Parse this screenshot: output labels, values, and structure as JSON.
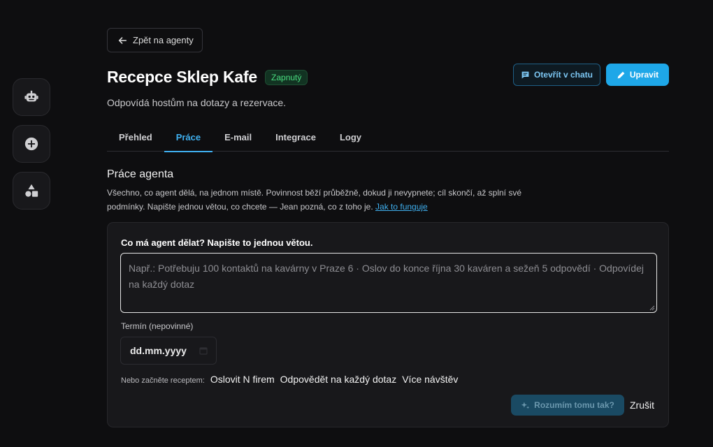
{
  "rail": {
    "items": [
      {
        "icon": "robot-icon"
      },
      {
        "icon": "plus-circle-icon"
      },
      {
        "icon": "shapes-icon"
      }
    ]
  },
  "header": {
    "back_label": "Zpět na agenty",
    "title": "Recepce Sklep Kafe",
    "status_badge": "Zapnutý",
    "subtitle": "Odpovídá hostům na dotazy a rezervace.",
    "open_chat_label": "Otevřít v chatu",
    "edit_label": "Upravit"
  },
  "tabs": [
    {
      "label": "Přehled",
      "active": false
    },
    {
      "label": "Práce",
      "active": true
    },
    {
      "label": "E-mail",
      "active": false
    },
    {
      "label": "Integrace",
      "active": false
    },
    {
      "label": "Logy",
      "active": false
    }
  ],
  "section": {
    "title": "Práce agenta",
    "description": "Všechno, co agent dělá, na jednom místě. Povinnost běží průběžně, dokud ji nevypnete; cíl skončí, až splní své podmínky. Napište jednou větou, co chcete — Jean pozná, co z toho je.",
    "help_link": "Jak to funguje"
  },
  "form": {
    "prompt_label": "Co má agent dělat? Napište to jednou větou.",
    "prompt_placeholder": "Např.: Potřebuju 100 kontaktů na kavárny v Praze 6 · Oslov do konce října 30 kaváren a sežeň 5 odpovědí · Odpovídej na každý dotaz",
    "deadline_label": "Termín (nepovinné)",
    "deadline_value": "dd.mm.yyyy",
    "recipes_label": "Nebo začněte receptem:",
    "recipes": [
      "Oslovit N firem",
      "Odpovědět na každý dotaz",
      "Více návštěv"
    ],
    "understand_label": "Rozumím tomu tak?",
    "cancel_label": "Zrušit"
  },
  "colors": {
    "background": "#0e0e10",
    "card": "#18181b",
    "accent": "#1ea7e8",
    "active_tab": "#3fb0f0",
    "status_green": "#4ade80"
  }
}
